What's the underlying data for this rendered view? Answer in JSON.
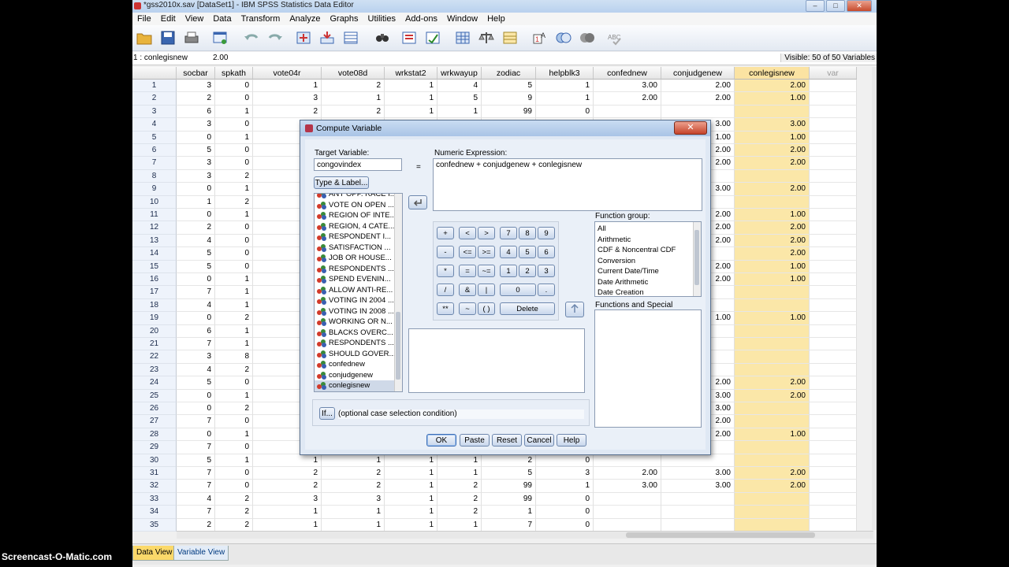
{
  "window": {
    "title": "*gss2010x.sav [DataSet1] - IBM SPSS Statistics Data Editor"
  },
  "menu": [
    "File",
    "Edit",
    "View",
    "Data",
    "Transform",
    "Analyze",
    "Graphs",
    "Utilities",
    "Add-ons",
    "Window",
    "Help"
  ],
  "cellbar": {
    "ref": "1 : conlegisnew",
    "value": "2.00",
    "visible": "Visible: 50 of 50 Variables"
  },
  "columns": [
    "socbar",
    "spkath",
    "vote04r",
    "vote08d",
    "wrkstat2",
    "wrkwayup",
    "zodiac",
    "helpblk3",
    "confednew",
    "conjudgenew",
    "conlegisnew",
    "var"
  ],
  "rows": [
    [
      "1",
      "3",
      "0",
      "1",
      "2",
      "1",
      "4",
      "5",
      "1",
      "3.00",
      "2.00",
      "2.00"
    ],
    [
      "2",
      "2",
      "0",
      "3",
      "1",
      "1",
      "5",
      "9",
      "1",
      "2.00",
      "2.00",
      "1.00"
    ],
    [
      "3",
      "6",
      "1",
      "2",
      "2",
      "1",
      "1",
      "99",
      "0",
      "",
      "",
      ""
    ],
    [
      "4",
      "3",
      "0",
      "",
      "",
      "",
      "",
      "",
      "",
      "",
      "3.00",
      "3.00"
    ],
    [
      "5",
      "0",
      "1",
      "",
      "",
      "",
      "",
      "",
      "",
      "",
      "1.00",
      "1.00"
    ],
    [
      "6",
      "5",
      "0",
      "",
      "",
      "",
      "",
      "",
      "",
      "",
      "2.00",
      "2.00"
    ],
    [
      "7",
      "3",
      "0",
      "",
      "",
      "",
      "",
      "",
      "",
      "",
      "2.00",
      "2.00"
    ],
    [
      "8",
      "3",
      "2",
      "",
      "",
      "",
      "",
      "",
      "",
      "",
      "",
      ""
    ],
    [
      "9",
      "0",
      "1",
      "",
      "",
      "",
      "",
      "",
      "",
      "",
      "3.00",
      "2.00"
    ],
    [
      "10",
      "1",
      "2",
      "",
      "",
      "",
      "",
      "",
      "",
      "",
      "",
      ""
    ],
    [
      "11",
      "0",
      "1",
      "",
      "",
      "",
      "",
      "",
      "",
      "",
      "2.00",
      "1.00"
    ],
    [
      "12",
      "2",
      "0",
      "",
      "",
      "",
      "",
      "",
      "",
      "",
      "2.00",
      "2.00"
    ],
    [
      "13",
      "4",
      "0",
      "",
      "",
      "",
      "",
      "",
      "",
      "",
      "2.00",
      "2.00"
    ],
    [
      "14",
      "5",
      "0",
      "",
      "",
      "",
      "",
      "",
      "",
      "",
      "",
      "2.00"
    ],
    [
      "15",
      "5",
      "0",
      "",
      "",
      "",
      "",
      "",
      "",
      "",
      "2.00",
      "1.00"
    ],
    [
      "16",
      "0",
      "1",
      "",
      "",
      "",
      "",
      "",
      "",
      "",
      "2.00",
      "1.00"
    ],
    [
      "17",
      "7",
      "1",
      "",
      "",
      "",
      "",
      "",
      "",
      "",
      "",
      ""
    ],
    [
      "18",
      "4",
      "1",
      "",
      "",
      "",
      "",
      "",
      "",
      "",
      "",
      ""
    ],
    [
      "19",
      "0",
      "2",
      "",
      "",
      "",
      "",
      "",
      "",
      "",
      "1.00",
      "1.00"
    ],
    [
      "20",
      "6",
      "1",
      "",
      "",
      "",
      "",
      "",
      "",
      "",
      "",
      ""
    ],
    [
      "21",
      "7",
      "1",
      "",
      "",
      "",
      "",
      "",
      "",
      "",
      "",
      ""
    ],
    [
      "22",
      "3",
      "8",
      "",
      "",
      "",
      "",
      "",
      "",
      "",
      "",
      ""
    ],
    [
      "23",
      "4",
      "2",
      "",
      "",
      "",
      "",
      "",
      "",
      "",
      "",
      ""
    ],
    [
      "24",
      "5",
      "0",
      "",
      "",
      "",
      "",
      "",
      "",
      "",
      "2.00",
      "2.00"
    ],
    [
      "25",
      "0",
      "1",
      "",
      "",
      "",
      "",
      "",
      "",
      "",
      "3.00",
      "2.00"
    ],
    [
      "26",
      "0",
      "2",
      "",
      "",
      "",
      "",
      "",
      "",
      "",
      "3.00",
      ""
    ],
    [
      "27",
      "7",
      "0",
      "",
      "",
      "",
      "",
      "",
      "",
      "",
      "2.00",
      ""
    ],
    [
      "28",
      "0",
      "1",
      "",
      "",
      "",
      "",
      "",
      "",
      "",
      "2.00",
      "1.00"
    ],
    [
      "29",
      "7",
      "0",
      "",
      "",
      "",
      "",
      "",
      "",
      "",
      "",
      ""
    ],
    [
      "30",
      "5",
      "1",
      "1",
      "1",
      "1",
      "1",
      "2",
      "0",
      "",
      "",
      ""
    ],
    [
      "31",
      "7",
      "0",
      "2",
      "2",
      "1",
      "1",
      "5",
      "3",
      "2.00",
      "3.00",
      "2.00"
    ],
    [
      "32",
      "7",
      "0",
      "2",
      "2",
      "1",
      "2",
      "99",
      "1",
      "3.00",
      "3.00",
      "2.00"
    ],
    [
      "33",
      "4",
      "2",
      "3",
      "3",
      "1",
      "2",
      "99",
      "0",
      "",
      "",
      ""
    ],
    [
      "34",
      "7",
      "2",
      "1",
      "1",
      "1",
      "2",
      "1",
      "0",
      "",
      "",
      ""
    ],
    [
      "35",
      "2",
      "2",
      "1",
      "1",
      "1",
      "1",
      "7",
      "0",
      "",
      "",
      ""
    ]
  ],
  "tabs": {
    "data_view": "Data View",
    "variable_view": "Variable View"
  },
  "watermark": "Screencast-O-Matic.com",
  "dialog": {
    "title": "Compute Variable",
    "close": "✕",
    "target_label": "Target Variable:",
    "target_value": "congovindex",
    "equals": "=",
    "type_label_btn": "Type & Label...",
    "numeric_label": "Numeric Expression:",
    "expression": "confednew + conjudgenew + conlegisnew",
    "variables": [
      "ANY OPP. RACE I...",
      "VOTE ON OPEN ...",
      "REGION OF INTE...",
      "REGION, 4 CATE...",
      "RESPONDENT I...",
      "SATISFACTION ...",
      "JOB OR HOUSE...",
      "RESPONDENTS ...",
      "SPEND EVENIN...",
      "ALLOW ANTI-RE...",
      "VOTING IN 2004 ...",
      "VOTING IN 2008 ...",
      "WORKING OR N...",
      "BLACKS OVERC...",
      "RESPONDENTS ...",
      "SHOULD GOVER...",
      "confednew",
      "conjudgenew",
      "conlegisnew"
    ],
    "keypad": [
      [
        "+",
        "<",
        ">",
        "7",
        "8",
        "9"
      ],
      [
        "-",
        "<=",
        ">=",
        "4",
        "5",
        "6"
      ],
      [
        "*",
        "=",
        "~=",
        "1",
        "2",
        "3"
      ],
      [
        "/",
        "&",
        "|",
        "0",
        "."
      ],
      [
        "**",
        "~",
        "( )",
        "Delete"
      ]
    ],
    "function_group_label": "Function group:",
    "function_groups": [
      "All",
      "Arithmetic",
      "CDF & Noncentral CDF",
      "Conversion",
      "Current Date/Time",
      "Date Arithmetic",
      "Date Creation"
    ],
    "functions_label": "Functions and Special Variables:",
    "if_btn": "If...",
    "if_text": "(optional case selection condition)",
    "buttons": {
      "ok": "OK",
      "paste": "Paste",
      "reset": "Reset",
      "cancel": "Cancel",
      "help": "Help"
    }
  }
}
